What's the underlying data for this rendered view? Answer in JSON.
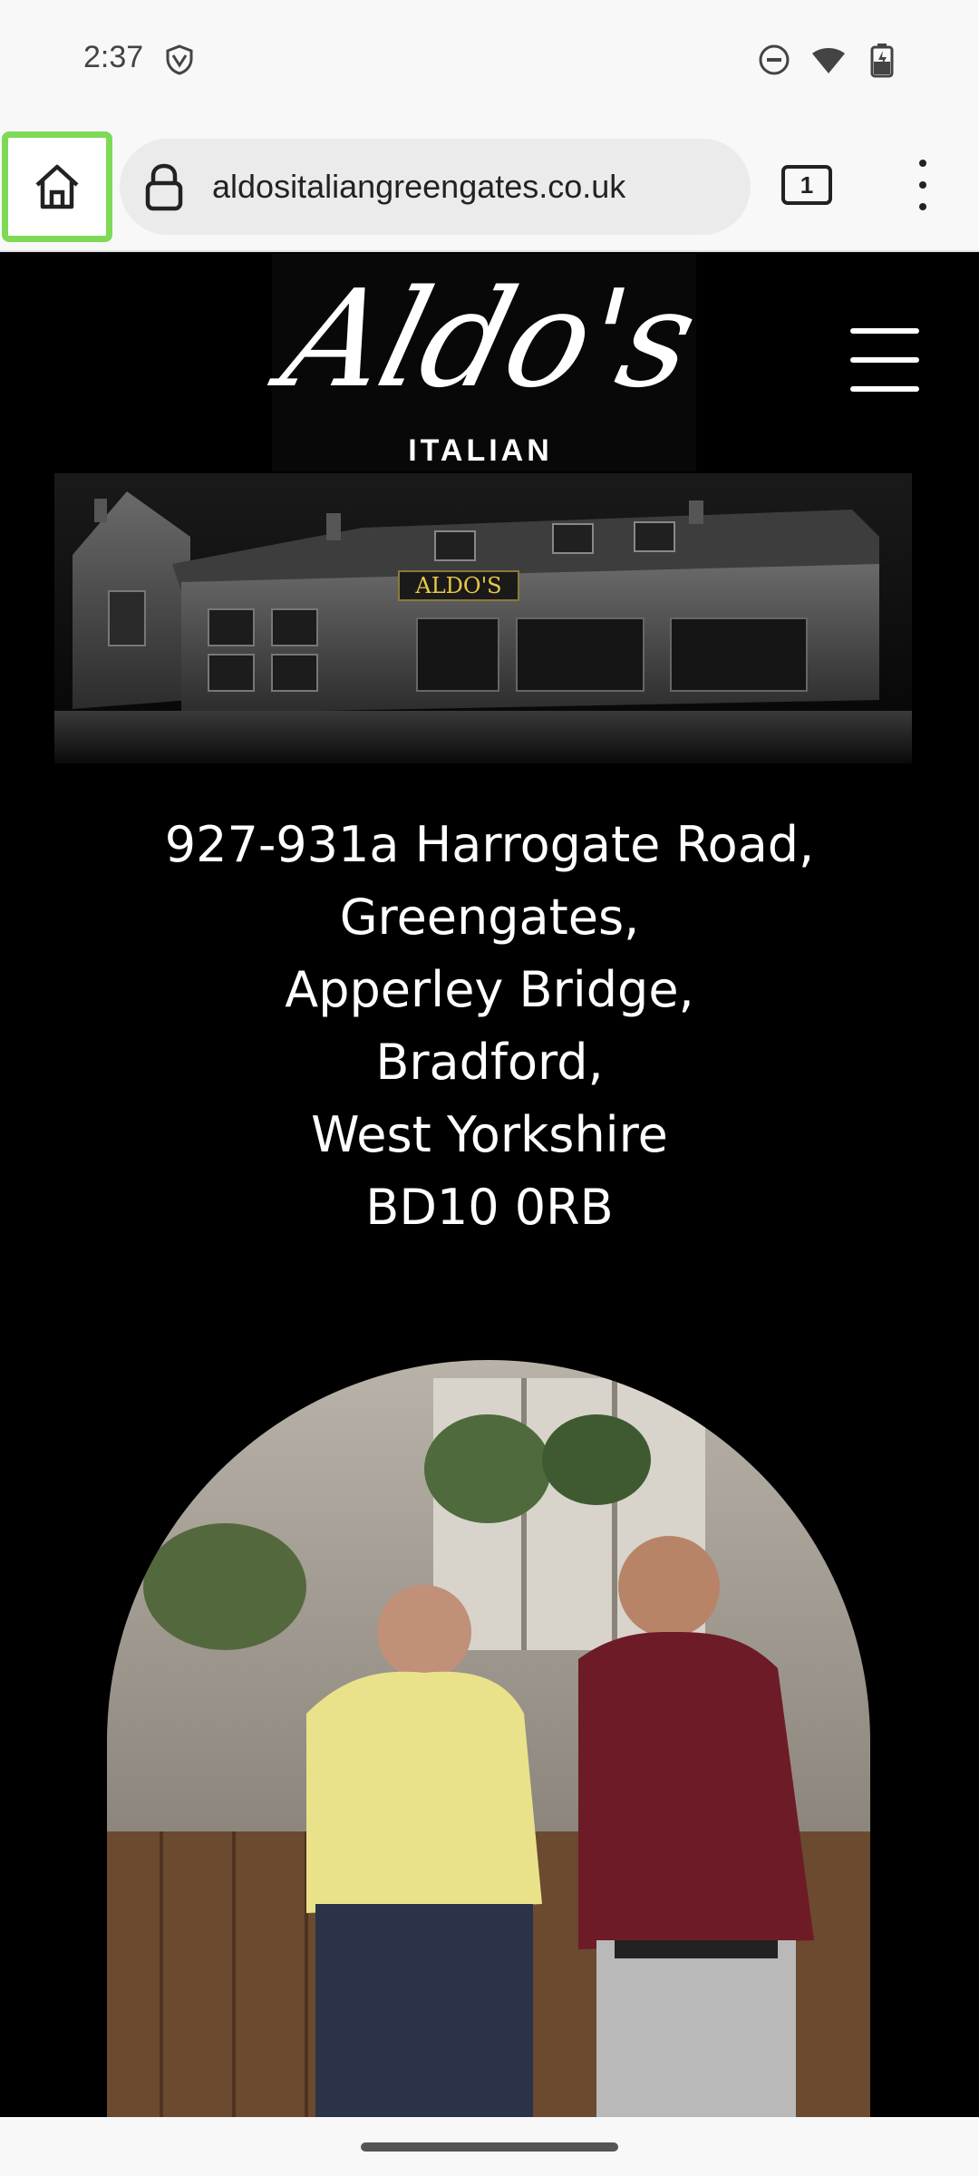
{
  "status_bar": {
    "time": "2:37",
    "icons": [
      "vpn-shield-icon",
      "do-not-disturb-icon",
      "wifi-icon",
      "battery-charging-icon"
    ]
  },
  "browser": {
    "url": "aldositaliangreengates.co.uk",
    "tab_count": "1",
    "icons": [
      "home-icon",
      "lock-icon",
      "tabs-icon",
      "more-menu-icon"
    ],
    "home_highlight_color": "#7ed957"
  },
  "site": {
    "logo_script": "Aldo's",
    "logo_sub": "ITALIAN",
    "sign_text": "ALDO'S",
    "address_lines": [
      "927-931a Harrogate Road,",
      "Greengates,",
      "Apperley Bridge,",
      "Bradford,",
      "West Yorkshire",
      "BD10 0RB"
    ]
  }
}
